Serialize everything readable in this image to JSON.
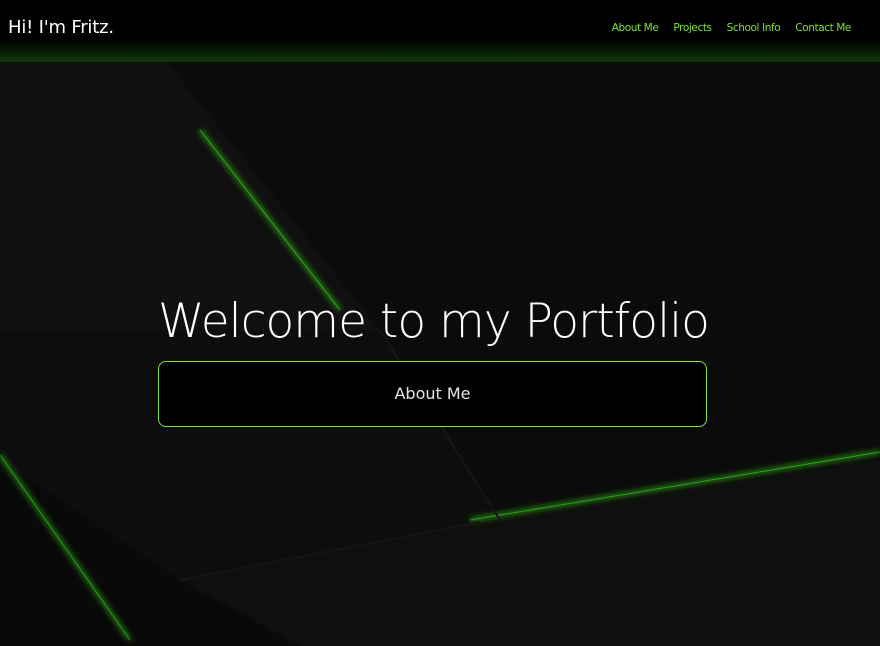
{
  "header": {
    "brand": "Hi! I'm Fritz.",
    "nav": [
      {
        "label": "About Me"
      },
      {
        "label": "Projects"
      },
      {
        "label": "School Info"
      },
      {
        "label": "Contact Me"
      }
    ]
  },
  "hero": {
    "title": "Welcome to my Portfolio",
    "button_label": "About Me"
  },
  "colors": {
    "accent": "#7be52d",
    "background": "#0c0c0c",
    "header_bg": "#000000",
    "text": "#ffffff"
  }
}
